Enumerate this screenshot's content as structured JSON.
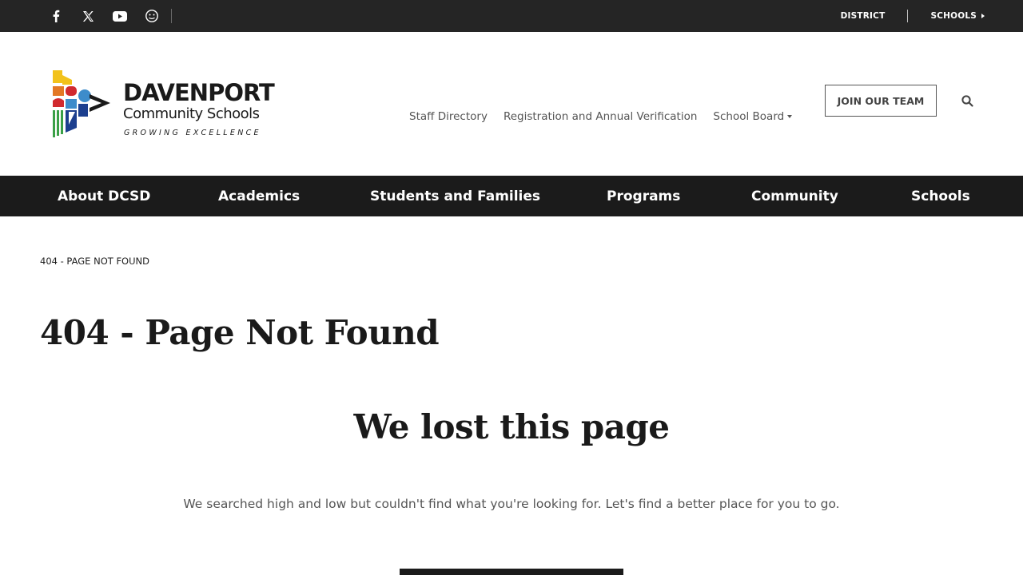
{
  "topbar": {
    "social_icons": [
      "facebook-icon",
      "x-twitter-icon",
      "youtube-icon",
      "peachjar-icon"
    ],
    "links": {
      "district": "DISTRICT",
      "schools": "SCHOOLS"
    }
  },
  "header": {
    "logo": {
      "name": "DAVENPORT",
      "subtitle": "Community Schools",
      "tagline": "GROWING EXCELLENCE",
      "colors": [
        "#f2c21b",
        "#e37825",
        "#d12a2f",
        "#3d8ccb",
        "#3aa047",
        "#1c3f8f"
      ]
    },
    "nav": {
      "staff_directory": "Staff Directory",
      "registration": "Registration and Annual Verification",
      "school_board": "School Board"
    },
    "join_button": "JOIN OUR TEAM",
    "search_icon": "search-icon"
  },
  "main_nav": [
    "About DCSD",
    "Academics",
    "Students and Families",
    "Programs",
    "Community",
    "Schools"
  ],
  "content": {
    "breadcrumb": "404 - PAGE NOT FOUND",
    "page_title": "404 - Page Not Found",
    "heading": "We lost this page",
    "description": "We searched high and low but couldn't find what you're looking for. Let's find a better place for you to go."
  },
  "colors": {
    "topbar_bg": "#252525",
    "nav_bg": "#1b1b1b",
    "text_dark": "#1a1a1a",
    "text_muted": "#555555"
  }
}
